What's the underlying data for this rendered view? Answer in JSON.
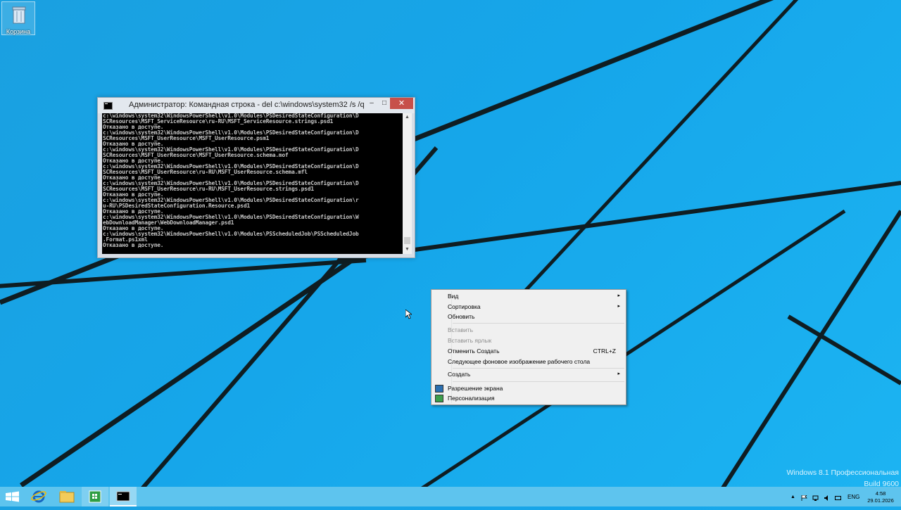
{
  "desktop": {
    "recycle_bin_label": "Корзина"
  },
  "cmd_window": {
    "title": "Администратор: Командная строка - del  c:\\windows\\system32 /s /q",
    "minimize_glyph": "–",
    "maximize_glyph": "□",
    "close_glyph": "✕",
    "console_lines": [
      "c:\\windows\\system32\\WindowsPowerShell\\v1.0\\Modules\\PSDesiredStateConfiguration\\D",
      "SCResources\\MSFT_ServiceResource\\ru-RU\\MSFT_ServiceResource.strings.psd1",
      "Отказано в доступе.",
      "c:\\windows\\system32\\WindowsPowerShell\\v1.0\\Modules\\PSDesiredStateConfiguration\\D",
      "SCResources\\MSFT_UserResource\\MSFT_UserResource.psm1",
      "Отказано в доступе.",
      "c:\\windows\\system32\\WindowsPowerShell\\v1.0\\Modules\\PSDesiredStateConfiguration\\D",
      "SCResources\\MSFT_UserResource\\MSFT_UserResource.schema.mof",
      "Отказано в доступе.",
      "c:\\windows\\system32\\WindowsPowerShell\\v1.0\\Modules\\PSDesiredStateConfiguration\\D",
      "SCResources\\MSFT_UserResource\\ru-RU\\MSFT_UserResource.schema.mfl",
      "Отказано в доступе.",
      "c:\\windows\\system32\\WindowsPowerShell\\v1.0\\Modules\\PSDesiredStateConfiguration\\D",
      "SCResources\\MSFT_UserResource\\ru-RU\\MSFT_UserResource.strings.psd1",
      "Отказано в доступе.",
      "c:\\windows\\system32\\WindowsPowerShell\\v1.0\\Modules\\PSDesiredStateConfiguration\\r",
      "u-RU\\PSDesiredStateConfiguration.Resource.psd1",
      "Отказано в доступе.",
      "c:\\windows\\system32\\WindowsPowerShell\\v1.0\\Modules\\PSDesiredStateConfiguration\\W",
      "ebDownloadManager\\WebDownloadManager.psd1",
      "Отказано в доступе.",
      "c:\\windows\\system32\\WindowsPowerShell\\v1.0\\Modules\\PSScheduledJob\\PSScheduledJob",
      ".Format.ps1xml",
      "Отказано в доступе."
    ]
  },
  "context_menu": {
    "items": [
      {
        "label": "Вид",
        "arrow": "▸"
      },
      {
        "label": "Сортировка",
        "arrow": "▸"
      },
      {
        "label": "Обновить"
      },
      {
        "label": "Вставить",
        "disabled": true
      },
      {
        "label": "Вставить ярлык",
        "disabled": true
      },
      {
        "label": "Отменить Создать",
        "shortcut": "CTRL+Z"
      },
      {
        "label": "Следующее фоновое изображение рабочего стола"
      },
      {
        "label": "Создать",
        "arrow": "▸"
      },
      {
        "label": "Разрешение экрана",
        "icon": "display-icon"
      },
      {
        "label": "Персонализация",
        "icon": "personalize-icon"
      }
    ]
  },
  "watermark": {
    "line1": "Windows 8.1 Профессиональная",
    "line2": "Build 9600"
  },
  "taskbar": {
    "buttons": [
      "start-icon",
      "internet-explorer-icon",
      "file-explorer-icon",
      "store-icon",
      "command-prompt-icon"
    ],
    "tray": {
      "language": "ENG",
      "time": "4:58",
      "date": "29.01.2026"
    }
  },
  "colors": {
    "wallpaper": "#1aa6e8",
    "taskbar": "#5ec4ee",
    "close_button": "#c7504a"
  }
}
